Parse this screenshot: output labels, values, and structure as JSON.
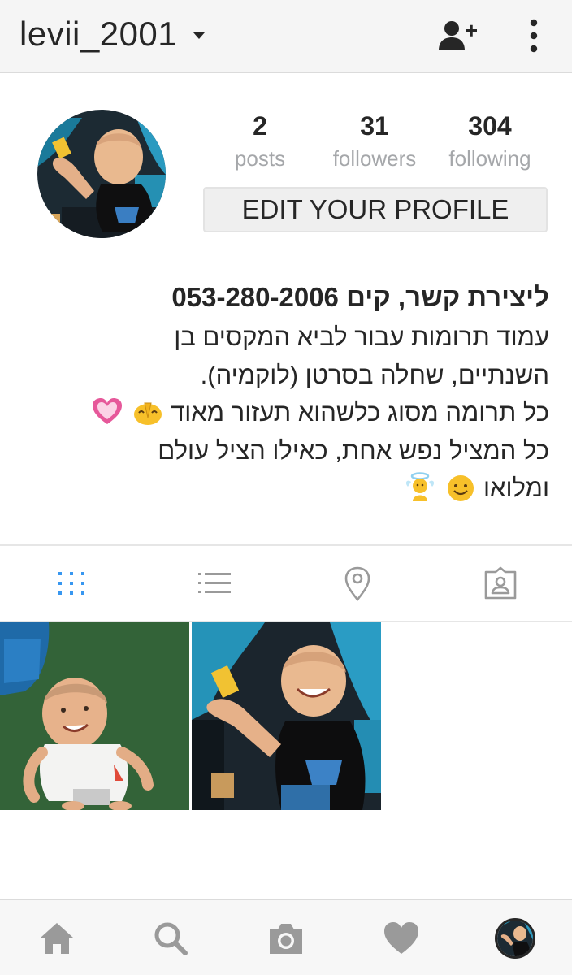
{
  "header": {
    "username": "levii_2001",
    "icons": [
      "chevron-down-icon",
      "add-user-icon",
      "more-vertical-icon"
    ]
  },
  "profile": {
    "avatar": "toddler-in-stroller-photo",
    "stats": [
      {
        "value": "2",
        "label": "posts"
      },
      {
        "value": "31",
        "label": "followers"
      },
      {
        "value": "304",
        "label": "following"
      }
    ],
    "edit_label": "EDIT YOUR PROFILE"
  },
  "bio": {
    "title": "ליצירת קשר, קים 053-280-2006",
    "lines": [
      "עמוד תרומות עבור לביא המקסים בן",
      "השנתיים, שחלה בסרטן (לוקמיה).",
      "כל תרומה מסוג כלשהוא תעזור מאוד",
      "כל המציל נפש אחת, כאילו הציל עולם",
      "ומלואו"
    ],
    "emojis": [
      "praying-hands-emoji",
      "heart-emoji",
      "smiling-face-emoji",
      "angel-emoji"
    ]
  },
  "tabs": [
    {
      "name": "grid",
      "icon": "grid-icon",
      "active": true
    },
    {
      "name": "list",
      "icon": "list-icon",
      "active": false
    },
    {
      "name": "map",
      "icon": "map-pin-icon",
      "active": false
    },
    {
      "name": "tagged",
      "icon": "tagged-person-icon",
      "active": false
    }
  ],
  "posts": [
    {
      "description": "toddler-on-grass-photo"
    },
    {
      "description": "toddler-in-stroller-photo"
    }
  ],
  "bottom_nav": [
    {
      "name": "home",
      "icon": "home-icon"
    },
    {
      "name": "search",
      "icon": "search-icon"
    },
    {
      "name": "camera",
      "icon": "camera-icon"
    },
    {
      "name": "activity",
      "icon": "heart-icon"
    },
    {
      "name": "profile",
      "icon": "profile-avatar"
    }
  ],
  "colors": {
    "accent": "#3897f0",
    "text": "#262626",
    "muted": "#a5a7aa",
    "icon_gray": "#9a9a9a",
    "bar_bg": "#f5f5f5"
  }
}
